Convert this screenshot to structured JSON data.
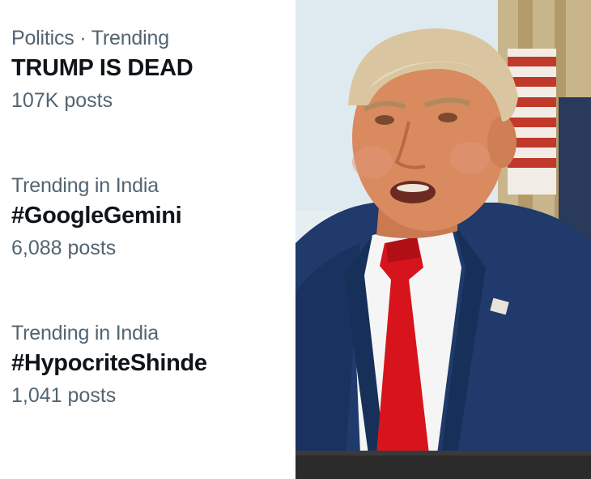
{
  "trends": [
    {
      "context": "Politics · Trending",
      "name": "TRUMP IS DEAD",
      "count": "107K posts"
    },
    {
      "context": "Trending in India",
      "name": "#GoogleGemini",
      "count": "6,088 posts"
    },
    {
      "context": "Trending in India",
      "name": "#HypocriteShinde",
      "count": "1,041 posts"
    }
  ],
  "photo": {
    "subject": "man-in-suit-red-tie-speaking",
    "colors": {
      "background_light": "#e6eef2",
      "curtain": "#c9b58c",
      "flag_red": "#c0392b",
      "skin": "#d98a5f",
      "hair": "#d9c6a0",
      "suit": "#1f3a6b",
      "shirt": "#f5f5f5",
      "tie": "#d7141c"
    }
  }
}
